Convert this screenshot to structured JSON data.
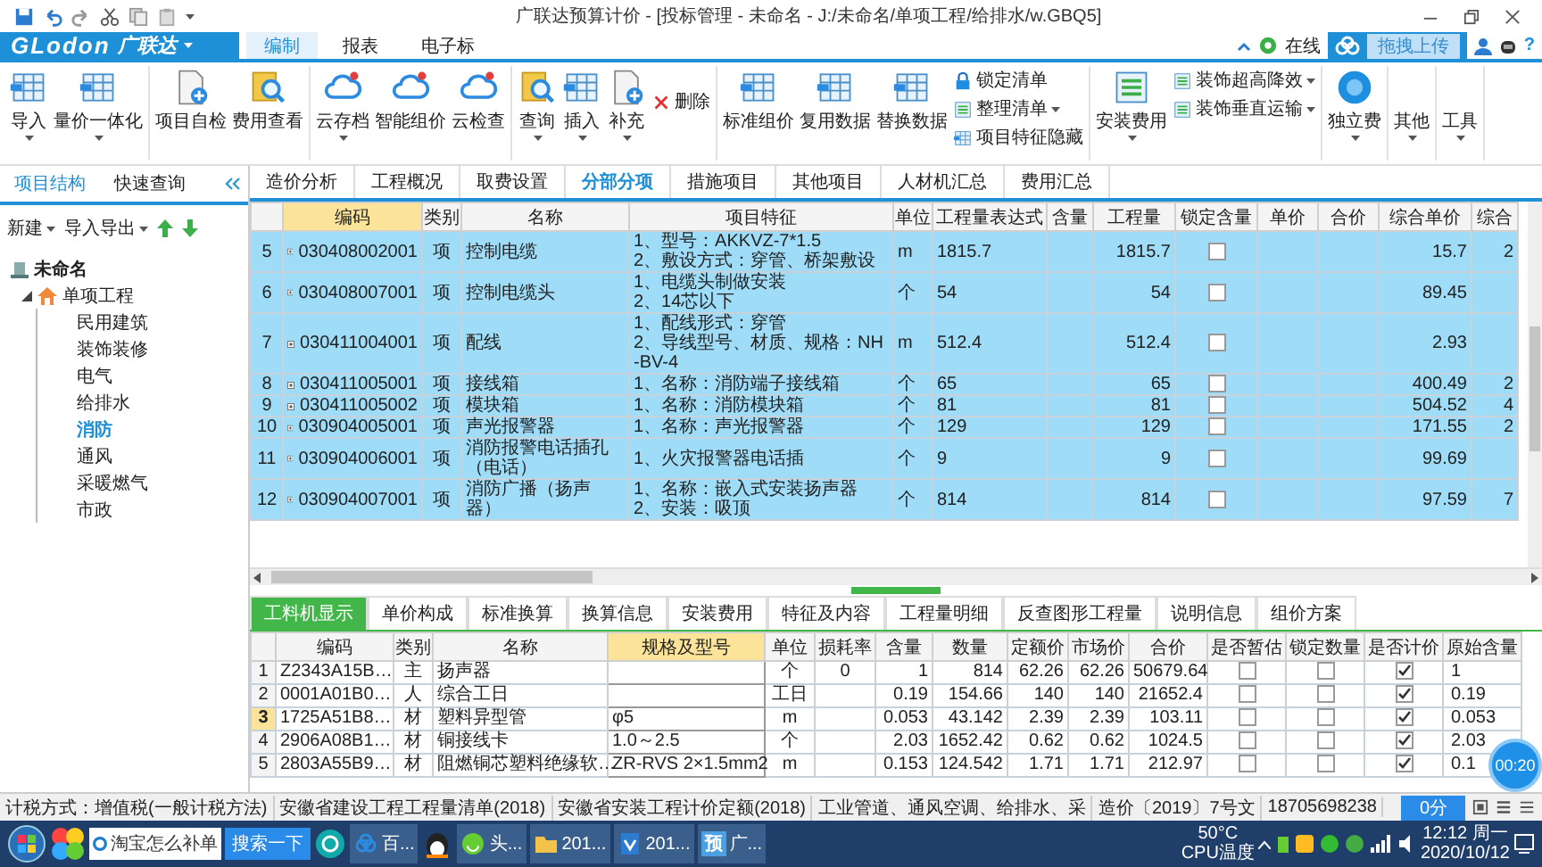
{
  "window": {
    "title": "广联达预算计价 - [投标管理 - 未命名 - J:/未命名/单项工程/给排水/w.GBQ5]"
  },
  "logo": {
    "brand": "GLodon",
    "name": "广联达"
  },
  "ribbon_tabs": [
    {
      "label": "编制",
      "selected": true
    },
    {
      "label": "报表",
      "selected": false
    },
    {
      "label": "电子标",
      "selected": false
    }
  ],
  "header_right": {
    "online": "在线",
    "upload": "拖拽上传",
    "help": "?"
  },
  "ribbon": {
    "groups": [
      {
        "items": [
          {
            "kind": "large",
            "label": "导入",
            "dropdown": true
          },
          {
            "kind": "large",
            "label": "量价一体化",
            "dropdown": true
          }
        ]
      },
      {
        "items": [
          {
            "kind": "large",
            "label": "项目自检",
            "dropdown": false
          },
          {
            "kind": "large",
            "label": "费用查看",
            "dropdown": false
          }
        ]
      },
      {
        "items": [
          {
            "kind": "large",
            "label": "云存档",
            "dropdown": true
          },
          {
            "kind": "large",
            "label": "智能组价",
            "dropdown": false
          },
          {
            "kind": "large",
            "label": "云检查",
            "dropdown": false
          }
        ]
      },
      {
        "items": [
          {
            "kind": "large",
            "label": "查询",
            "dropdown": true
          },
          {
            "kind": "large",
            "label": "插入",
            "dropdown": true
          },
          {
            "kind": "large",
            "label": "补充",
            "dropdown": true
          },
          {
            "kind": "small",
            "label": "删除",
            "dropdown": false
          }
        ]
      },
      {
        "items": [
          {
            "kind": "large",
            "label": "标准组价",
            "dropdown": false
          },
          {
            "kind": "large",
            "label": "复用数据",
            "dropdown": false
          },
          {
            "kind": "large",
            "label": "替换数据",
            "dropdown": false
          },
          {
            "kind": "stack",
            "items": [
              {
                "label": "锁定清单",
                "dropdown": false
              },
              {
                "label": "整理清单",
                "dropdown": true
              },
              {
                "label": "项目特征隐藏",
                "dropdown": false
              }
            ]
          }
        ]
      },
      {
        "items": [
          {
            "kind": "large",
            "label": "安装费用",
            "dropdown": true
          },
          {
            "kind": "stack",
            "items": [
              {
                "label": "装饰超高降效",
                "dropdown": true
              },
              {
                "label": "装饰垂直运输",
                "dropdown": true
              }
            ]
          }
        ]
      },
      {
        "items": [
          {
            "kind": "large",
            "label": "独立费",
            "dropdown": true
          }
        ]
      },
      {
        "items": [
          {
            "kind": "large",
            "label": "其他",
            "dropdown": true
          }
        ]
      },
      {
        "items": [
          {
            "kind": "large",
            "label": "工具",
            "dropdown": true
          }
        ]
      }
    ]
  },
  "left_panel": {
    "tabs": [
      {
        "label": "项目结构",
        "selected": true
      },
      {
        "label": "快速查询",
        "selected": false
      }
    ],
    "toolbar": [
      {
        "label": "新建",
        "dropdown": true
      },
      {
        "label": "导入导出",
        "dropdown": true
      }
    ],
    "tree": {
      "label": "未命名",
      "selected": false,
      "children": [
        {
          "label": "单项工程",
          "selected": false,
          "expanded": true,
          "children": [
            {
              "label": "民用建筑",
              "selected": false
            },
            {
              "label": "装饰装修",
              "selected": false
            },
            {
              "label": "电气",
              "selected": false
            },
            {
              "label": "给排水",
              "selected": false
            },
            {
              "label": "消防",
              "selected": true
            },
            {
              "label": "通风",
              "selected": false
            },
            {
              "label": "采暖燃气",
              "selected": false
            },
            {
              "label": "市政",
              "selected": false
            }
          ]
        }
      ]
    }
  },
  "main_tabs": [
    {
      "label": "造价分析",
      "selected": false
    },
    {
      "label": "工程概况",
      "selected": false
    },
    {
      "label": "取费设置",
      "selected": false
    },
    {
      "label": "分部分项",
      "selected": true
    },
    {
      "label": "措施项目",
      "selected": false
    },
    {
      "label": "其他项目",
      "selected": false
    },
    {
      "label": "人材机汇总",
      "selected": false
    },
    {
      "label": "费用汇总",
      "selected": false
    }
  ],
  "main_table": {
    "columns": [
      {
        "label": "编码",
        "current": true
      },
      {
        "label": "类别",
        "current": false
      },
      {
        "label": "名称",
        "current": false
      },
      {
        "label": "项目特征",
        "current": false
      },
      {
        "label": "单位",
        "current": false
      },
      {
        "label": "工程量表达式",
        "current": false
      },
      {
        "label": "含量",
        "current": false
      },
      {
        "label": "工程量",
        "current": false
      },
      {
        "label": "锁定含量",
        "current": false
      },
      {
        "label": "单价",
        "current": false
      },
      {
        "label": "合价",
        "current": false
      },
      {
        "label": "综合单价",
        "current": false
      },
      {
        "label": "综合",
        "current": false
      }
    ],
    "rows": [
      {
        "no": "5",
        "code": "030408002001",
        "type": "项",
        "name": "控制电缆",
        "feature": "1、型号：AKKVZ-7*1.5\n2、敷设方式：穿管、桥架敷设",
        "unit": "m",
        "expr": "1815.7",
        "qty": "1815.7",
        "locked": false,
        "unit_price": "15.7",
        "column_13": "2",
        "selected": true
      },
      {
        "no": "6",
        "code": "030408007001",
        "type": "项",
        "name": "控制电缆头",
        "feature": "1、电缆头制做安装\n2、14芯以下",
        "unit": "个",
        "expr": "54",
        "qty": "54",
        "locked": false,
        "unit_price": "89.45",
        "selected": true
      },
      {
        "no": "7",
        "code": "030411004001",
        "type": "项",
        "name": "配线",
        "feature": "1、配线形式：穿管\n2、导线型号、材质、规格：NH-BV-4",
        "unit": "m",
        "expr": "512.4",
        "qty": "512.4",
        "locked": false,
        "unit_price": "2.93",
        "selected": true
      },
      {
        "no": "8",
        "code": "030411005001",
        "type": "项",
        "name": "接线箱",
        "feature": "1、名称：消防端子接线箱",
        "unit": "个",
        "expr": "65",
        "qty": "65",
        "locked": false,
        "unit_price": "400.49",
        "column_13": "2",
        "selected": true
      },
      {
        "no": "9",
        "code": "030411005002",
        "type": "项",
        "name": "模块箱",
        "feature": "1、名称：消防模块箱",
        "unit": "个",
        "expr": "81",
        "qty": "81",
        "locked": false,
        "unit_price": "504.52",
        "column_13": "4",
        "selected": true
      },
      {
        "no": "10",
        "code": "030904005001",
        "type": "项",
        "name": "声光报警器",
        "feature": "1、名称：声光报警器",
        "unit": "个",
        "expr": "129",
        "qty": "129",
        "locked": false,
        "unit_price": "171.55",
        "column_13": "2",
        "selected": true
      },
      {
        "no": "11",
        "code": "030904006001",
        "type": "项",
        "name": "消防报警电话插孔（电话）",
        "feature": "1、火灾报警器电话插",
        "unit": "个",
        "expr": "9",
        "qty": "9",
        "locked": false,
        "unit_price": "99.69",
        "selected": true
      },
      {
        "no": "12",
        "code": "030904007001",
        "type": "项",
        "name": "消防广播（扬声器）",
        "feature": "1、名称：嵌入式安装扬声器\n2、安装：吸顶",
        "unit": "个",
        "expr": "814",
        "qty": "814",
        "locked": false,
        "unit_price": "97.59",
        "column_13": "7",
        "selected": true
      }
    ]
  },
  "bottom_tabs": [
    {
      "label": "工料机显示",
      "selected": true
    },
    {
      "label": "单价构成",
      "selected": false
    },
    {
      "label": "标准换算",
      "selected": false
    },
    {
      "label": "换算信息",
      "selected": false
    },
    {
      "label": "安装费用",
      "selected": false
    },
    {
      "label": "特征及内容",
      "selected": false
    },
    {
      "label": "工程量明细",
      "selected": false
    },
    {
      "label": "反查图形工程量",
      "selected": false
    },
    {
      "label": "说明信息",
      "selected": false
    },
    {
      "label": "组价方案",
      "selected": false
    }
  ],
  "bottom_table": {
    "columns": [
      {
        "label": "编码",
        "current": false
      },
      {
        "label": "类别",
        "current": false
      },
      {
        "label": "名称",
        "current": false
      },
      {
        "label": "规格及型号",
        "current": true
      },
      {
        "label": "单位",
        "current": false
      },
      {
        "label": "损耗率",
        "current": false
      },
      {
        "label": "含量",
        "current": false
      },
      {
        "label": "数量",
        "current": false
      },
      {
        "label": "定额价",
        "current": false
      },
      {
        "label": "市场价",
        "current": false
      },
      {
        "label": "合价",
        "current": false
      },
      {
        "label": "是否暂估",
        "current": false
      },
      {
        "label": "锁定数量",
        "current": false
      },
      {
        "label": "是否计价",
        "current": false
      },
      {
        "label": "原始含量",
        "current": false
      }
    ],
    "rows": [
      {
        "no": "1",
        "code": "Z2343A15B…",
        "type": "主",
        "name": "扬声器",
        "unit": "个",
        "loss": "0",
        "content": "1",
        "qty": "814",
        "base_price": "62.26",
        "market_price": "62.26",
        "total": "50679.64",
        "provisional": false,
        "qty_locked": false,
        "priced": true,
        "original": "1",
        "selected": false
      },
      {
        "no": "2",
        "code": "0001A01B0…",
        "type": "人",
        "name": "综合工日",
        "unit": "工日",
        "content": "0.19",
        "qty": "154.66",
        "base_price": "140",
        "market_price": "140",
        "total": "21652.4",
        "provisional": false,
        "qty_locked": false,
        "priced": true,
        "original": "0.19",
        "selected": false
      },
      {
        "no": "3",
        "code": "1725A51B8…",
        "type": "材",
        "name": "塑料异型管",
        "spec": "φ5",
        "unit": "m",
        "content": "0.053",
        "qty": "43.142",
        "base_price": "2.39",
        "market_price": "2.39",
        "total": "103.11",
        "provisional": false,
        "qty_locked": false,
        "priced": true,
        "original": "0.053",
        "selected": true
      },
      {
        "no": "4",
        "code": "2906A08B1…",
        "type": "材",
        "name": "铜接线卡",
        "spec": "1.0～2.5",
        "unit": "个",
        "content": "2.03",
        "qty": "1652.42",
        "base_price": "0.62",
        "market_price": "0.62",
        "total": "1024.5",
        "provisional": false,
        "qty_locked": false,
        "priced": true,
        "original": "2.03",
        "selected": false
      },
      {
        "no": "5",
        "code": "2803A55B9…",
        "type": "材",
        "name": "阻燃铜芯塑料绝缘软…",
        "spec": "ZR-RVS 2×1.5mm2",
        "unit": "m",
        "content": "0.153",
        "qty": "124.542",
        "base_price": "1.71",
        "market_price": "1.71",
        "total": "212.97",
        "provisional": false,
        "qty_locked": false,
        "priced": true,
        "original": "0.1",
        "selected": false
      }
    ]
  },
  "timer": "00:20",
  "status_bar": {
    "items": [
      "计税方式：增值税(一般计税方法)",
      "安徽省建设工程工程量清单(2018)",
      "安徽省安装工程计价定额(2018)",
      "工业管道、通风空调、给排水、采",
      "造价〔2019〕7号文",
      "18705698238"
    ],
    "score": "0分"
  },
  "taskbar": {
    "search_value": "淘宝怎么补单",
    "search_button": "搜索一下",
    "tasks": [
      {
        "label": "百..."
      },
      {
        "label": "头..."
      },
      {
        "label": "201..."
      },
      {
        "label": "201..."
      },
      {
        "label": "广...",
        "badge": "预"
      }
    ],
    "temperature": "50°C",
    "temperature_label": "CPU温度",
    "time": "12:12 周一",
    "date": "2020/10/12"
  }
}
